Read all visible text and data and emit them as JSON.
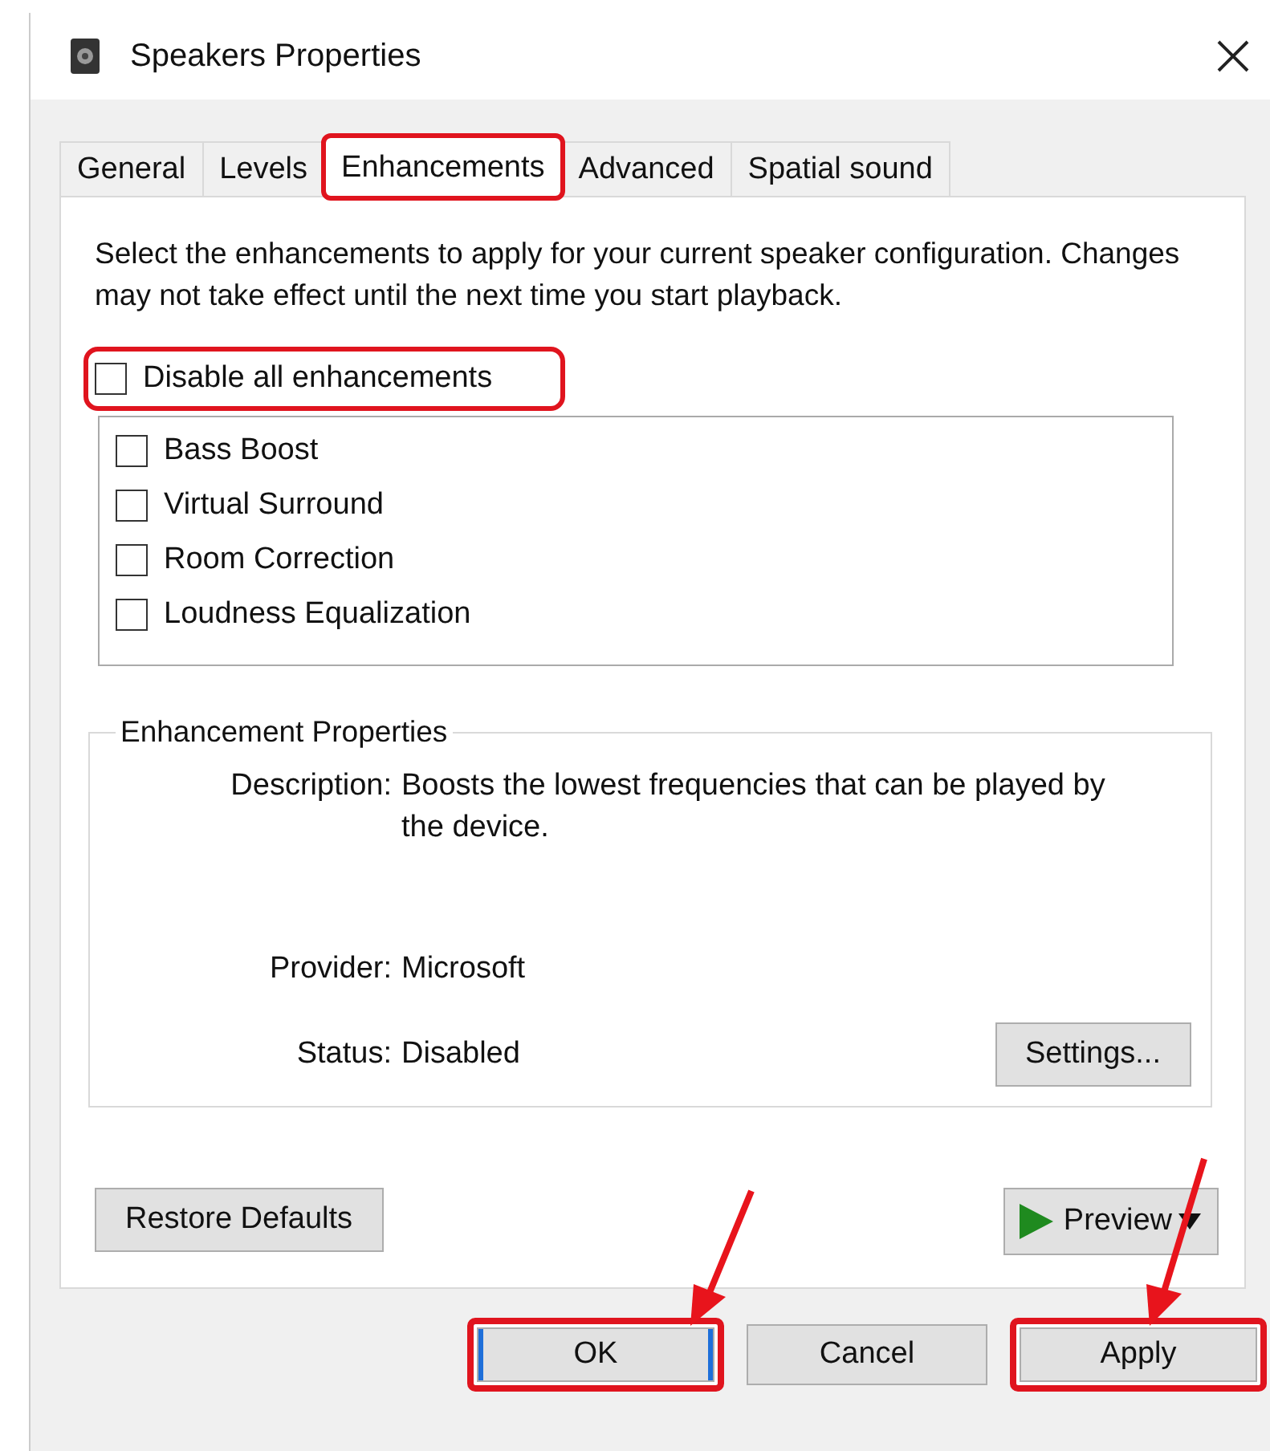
{
  "window": {
    "title": "Speakers Properties"
  },
  "tabs": [
    {
      "label": "General",
      "selected": false,
      "highlighted": false
    },
    {
      "label": "Levels",
      "selected": false,
      "highlighted": false
    },
    {
      "label": "Enhancements",
      "selected": true,
      "highlighted": true
    },
    {
      "label": "Advanced",
      "selected": false,
      "highlighted": false
    },
    {
      "label": "Spatial sound",
      "selected": false,
      "highlighted": false
    }
  ],
  "intro": "Select the enhancements to apply for your current speaker configuration. Changes may not take effect until the next time you start playback.",
  "disable_all": {
    "label": "Disable all enhancements",
    "checked": false,
    "highlighted": true
  },
  "enhancements": [
    {
      "label": "Bass Boost",
      "checked": false
    },
    {
      "label": "Virtual Surround",
      "checked": false
    },
    {
      "label": "Room Correction",
      "checked": false
    },
    {
      "label": "Loudness Equalization",
      "checked": false
    }
  ],
  "properties": {
    "title": "Enhancement Properties",
    "description_label": "Description:",
    "description": "Boosts the lowest frequencies that can be played by the device.",
    "provider_label": "Provider:",
    "provider": "Microsoft",
    "status_label": "Status:",
    "status": "Disabled",
    "settings_button": "Settings..."
  },
  "restore_button": "Restore Defaults",
  "preview_button": "Preview",
  "dialog_buttons": [
    {
      "label": "OK",
      "highlighted": true,
      "focused": true
    },
    {
      "label": "Cancel",
      "highlighted": false,
      "focused": false
    },
    {
      "label": "Apply",
      "highlighted": true,
      "focused": false
    }
  ]
}
